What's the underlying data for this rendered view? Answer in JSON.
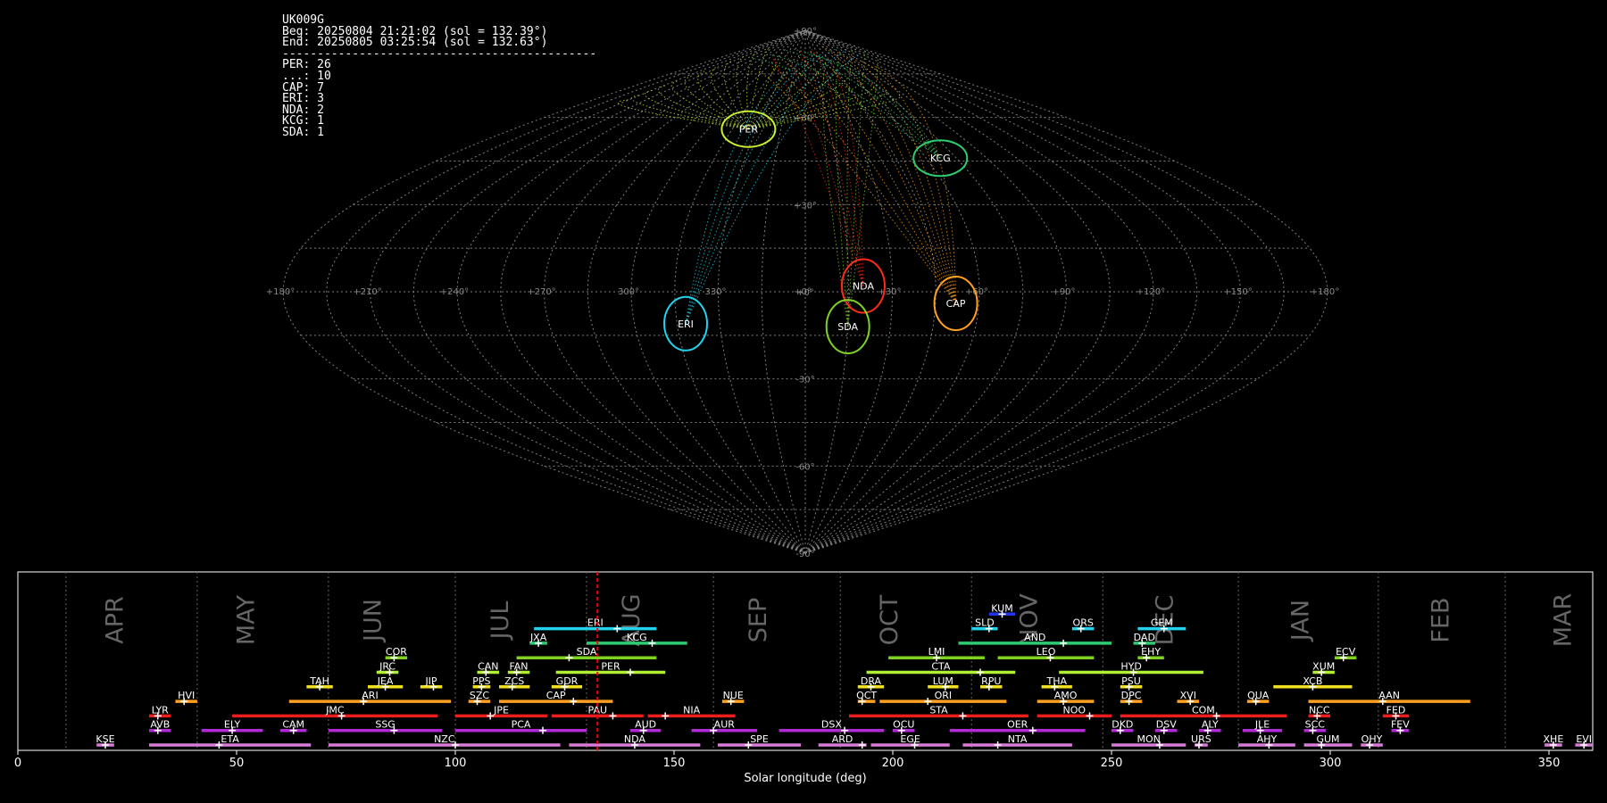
{
  "header": {
    "station": "UK009G",
    "begin": "Beg: 20250804 21:21:02 (sol = 132.39°)",
    "end": "End: 20250805 03:25:54 (sol = 132.63°)",
    "separator": "---------------------------------------------"
  },
  "summary": [
    {
      "text": "PER: 26"
    },
    {
      "text": "...: 10"
    },
    {
      "text": "CAP: 7"
    },
    {
      "text": "ERI: 3"
    },
    {
      "text": "NDA: 2"
    },
    {
      "text": "KCG: 1"
    },
    {
      "text": "SDA: 1"
    }
  ],
  "colors": {
    "background": "#000000",
    "grid": "#8c8c8c",
    "current_line": "#ff0000",
    "frame": "#ffffff"
  },
  "chart_data": [
    {
      "type": "scatter",
      "projection": "sinusoidal",
      "grid": true,
      "lon_tick_labels": [
        "+180°",
        "+150°",
        "+120°",
        "+90°",
        "+60°",
        "+30°",
        "+0°",
        "330°",
        "300°",
        "+270°",
        "+240°",
        "+210°",
        "+180°"
      ],
      "lat_tick_labels": [
        "+90°",
        "+60°",
        "+30°",
        "+0°",
        "-30°",
        "-60°",
        "-90°"
      ],
      "radiants": [
        {
          "name": "PER",
          "lon": 35,
          "lat": 56,
          "color": "#c8f032"
        },
        {
          "name": "KCG",
          "lon": 293,
          "lat": 46,
          "color": "#2ecc71"
        },
        {
          "name": "NDA",
          "lon": 340,
          "lat": 2,
          "color": "#ff2a1a"
        },
        {
          "name": "CAP",
          "lon": 308,
          "lat": -4,
          "color": "#ffa020"
        },
        {
          "name": "ERI",
          "lon": 42,
          "lat": -11,
          "color": "#22d3ee"
        },
        {
          "name": "SDA",
          "lon": 345,
          "lat": -12,
          "color": "#7ed321"
        }
      ]
    },
    {
      "type": "bar",
      "xlabel": "Solar longitude (deg)",
      "xlim": [
        0,
        360
      ],
      "x_tick_labels": [
        "0",
        "50",
        "100",
        "150",
        "200",
        "250",
        "300",
        "350"
      ],
      "current_sol": 132.5,
      "month_boundaries": [
        11,
        41,
        71,
        100,
        130,
        159,
        188,
        218,
        248,
        279,
        311,
        340
      ],
      "months": [
        {
          "label": "APR",
          "sol": 24
        },
        {
          "label": "MAY",
          "sol": 54
        },
        {
          "label": "JUN",
          "sol": 83
        },
        {
          "label": "JUL",
          "sol": 112
        },
        {
          "label": "AUG",
          "sol": 142
        },
        {
          "label": "SEP",
          "sol": 171
        },
        {
          "label": "OCT",
          "sol": 201
        },
        {
          "label": "NOV",
          "sol": 233
        },
        {
          "label": "DEC",
          "sol": 264
        },
        {
          "label": "JAN",
          "sol": 295
        },
        {
          "label": "FEB",
          "sol": 327
        },
        {
          "label": "MAR",
          "sol": 355
        }
      ],
      "showers": [
        {
          "name": "KUM",
          "start": 222,
          "end": 228,
          "peak": 225,
          "row": 10,
          "color": "#2233ee"
        },
        {
          "name": "ERI",
          "start": 118,
          "end": 146,
          "peak": 137,
          "row": 9,
          "color": "#22d3ee"
        },
        {
          "name": "SLD",
          "start": 218,
          "end": 224,
          "peak": 222,
          "row": 9,
          "color": "#22d3ee"
        },
        {
          "name": "ORS",
          "start": 241,
          "end": 246,
          "peak": 243,
          "row": 9,
          "color": "#22d3ee"
        },
        {
          "name": "GEM",
          "start": 256,
          "end": 267,
          "peak": 262,
          "row": 9,
          "color": "#22d3ee"
        },
        {
          "name": "JXA",
          "start": 117,
          "end": 121,
          "peak": 119,
          "row": 8,
          "color": "#2ecc71"
        },
        {
          "name": "KCG",
          "start": 130,
          "end": 153,
          "peak": 145,
          "row": 8,
          "color": "#2ecc71"
        },
        {
          "name": "AND",
          "start": 215,
          "end": 250,
          "peak": 239,
          "row": 8,
          "color": "#2ecc71"
        },
        {
          "name": "DAD",
          "start": 255,
          "end": 260,
          "peak": 257,
          "row": 8,
          "color": "#2ecc71"
        },
        {
          "name": "COR",
          "start": 84,
          "end": 89,
          "peak": 86,
          "row": 7,
          "color": "#7ed321"
        },
        {
          "name": "SDA",
          "start": 114,
          "end": 146,
          "peak": 126,
          "row": 7,
          "color": "#7ed321"
        },
        {
          "name": "LMI",
          "start": 199,
          "end": 221,
          "peak": 210,
          "row": 7,
          "color": "#7ed321"
        },
        {
          "name": "LEO",
          "start": 224,
          "end": 246,
          "peak": 236,
          "row": 7,
          "color": "#7ed321"
        },
        {
          "name": "EHY",
          "start": 256,
          "end": 262,
          "peak": 258,
          "row": 7,
          "color": "#7ed321"
        },
        {
          "name": "ECV",
          "start": 301,
          "end": 306,
          "peak": 303,
          "row": 7,
          "color": "#7ed321"
        },
        {
          "name": "JRC",
          "start": 82,
          "end": 87,
          "peak": 85,
          "row": 6,
          "color": "#b0f030"
        },
        {
          "name": "CAN",
          "start": 105,
          "end": 110,
          "peak": 107,
          "row": 6,
          "color": "#b0f030"
        },
        {
          "name": "FAN",
          "start": 112,
          "end": 117,
          "peak": 114,
          "row": 6,
          "color": "#b0f030"
        },
        {
          "name": "PER",
          "start": 123,
          "end": 148,
          "peak": 140,
          "row": 6,
          "color": "#b0f030"
        },
        {
          "name": "CTA",
          "start": 194,
          "end": 228,
          "peak": 220,
          "row": 6,
          "color": "#b0f030"
        },
        {
          "name": "HYD",
          "start": 238,
          "end": 271,
          "peak": 255,
          "row": 6,
          "color": "#b0f030"
        },
        {
          "name": "XUM",
          "start": 296,
          "end": 301,
          "peak": 298,
          "row": 6,
          "color": "#b0f030"
        },
        {
          "name": "TAH",
          "start": 66,
          "end": 72,
          "peak": 69,
          "row": 5,
          "color": "#f0e020"
        },
        {
          "name": "JEA",
          "start": 80,
          "end": 88,
          "peak": 84,
          "row": 5,
          "color": "#f0e020"
        },
        {
          "name": "JIP",
          "start": 92,
          "end": 97,
          "peak": 95,
          "row": 5,
          "color": "#f0e020"
        },
        {
          "name": "PPS",
          "start": 104,
          "end": 108,
          "peak": 106,
          "row": 5,
          "color": "#f0e020"
        },
        {
          "name": "ZCS",
          "start": 110,
          "end": 117,
          "peak": 113,
          "row": 5,
          "color": "#f0e020"
        },
        {
          "name": "GDR",
          "start": 122,
          "end": 129,
          "peak": 125,
          "row": 5,
          "color": "#f0e020"
        },
        {
          "name": "DRA",
          "start": 192,
          "end": 198,
          "peak": 195,
          "row": 5,
          "color": "#f0e020"
        },
        {
          "name": "LUM",
          "start": 208,
          "end": 215,
          "peak": 212,
          "row": 5,
          "color": "#f0e020"
        },
        {
          "name": "RPU",
          "start": 220,
          "end": 225,
          "peak": 222,
          "row": 5,
          "color": "#f0e020"
        },
        {
          "name": "THA",
          "start": 234,
          "end": 241,
          "peak": 237,
          "row": 5,
          "color": "#f0e020"
        },
        {
          "name": "PSU",
          "start": 252,
          "end": 257,
          "peak": 254,
          "row": 5,
          "color": "#f0e020"
        },
        {
          "name": "XCB",
          "start": 287,
          "end": 305,
          "peak": 296,
          "row": 5,
          "color": "#f0e020"
        },
        {
          "name": "HVI",
          "start": 36,
          "end": 41,
          "peak": 38,
          "row": 4,
          "color": "#ffa020"
        },
        {
          "name": "ARI",
          "start": 62,
          "end": 99,
          "peak": 79,
          "row": 4,
          "color": "#ffa020"
        },
        {
          "name": "SZC",
          "start": 103,
          "end": 108,
          "peak": 105,
          "row": 4,
          "color": "#ffa020"
        },
        {
          "name": "CAP",
          "start": 110,
          "end": 136,
          "peak": 127,
          "row": 4,
          "color": "#ffa020"
        },
        {
          "name": "NUE",
          "start": 161,
          "end": 166,
          "peak": 163,
          "row": 4,
          "color": "#ffa020"
        },
        {
          "name": "OCT",
          "start": 192,
          "end": 196,
          "peak": 193,
          "row": 4,
          "color": "#ffa020"
        },
        {
          "name": "ORI",
          "start": 197,
          "end": 226,
          "peak": 208,
          "row": 4,
          "color": "#ffa020"
        },
        {
          "name": "AMO",
          "start": 233,
          "end": 246,
          "peak": 239,
          "row": 4,
          "color": "#ffa020"
        },
        {
          "name": "DPC",
          "start": 252,
          "end": 257,
          "peak": 254,
          "row": 4,
          "color": "#ffa020"
        },
        {
          "name": "XVI",
          "start": 265,
          "end": 270,
          "peak": 268,
          "row": 4,
          "color": "#ffa020"
        },
        {
          "name": "QUA",
          "start": 281,
          "end": 286,
          "peak": 283,
          "row": 4,
          "color": "#ffa020"
        },
        {
          "name": "AAN",
          "start": 295,
          "end": 332,
          "peak": 312,
          "row": 4,
          "color": "#ffa020"
        },
        {
          "name": "LYR",
          "start": 30,
          "end": 35,
          "peak": 32,
          "row": 3,
          "color": "#ee1d1d"
        },
        {
          "name": "JMC",
          "start": 49,
          "end": 96,
          "peak": 74,
          "row": 3,
          "color": "#ee1d1d"
        },
        {
          "name": "JPE",
          "start": 100,
          "end": 121,
          "peak": 108,
          "row": 3,
          "color": "#ee1d1d"
        },
        {
          "name": "PAU",
          "start": 122,
          "end": 143,
          "peak": 136,
          "row": 3,
          "color": "#ee1d1d"
        },
        {
          "name": "NIA",
          "start": 144,
          "end": 164,
          "peak": 148,
          "row": 3,
          "color": "#ee1d1d"
        },
        {
          "name": "STA",
          "start": 190,
          "end": 231,
          "peak": 216,
          "row": 3,
          "color": "#ee1d1d"
        },
        {
          "name": "NOO",
          "start": 233,
          "end": 250,
          "peak": 245,
          "row": 3,
          "color": "#ee1d1d"
        },
        {
          "name": "COM",
          "start": 252,
          "end": 290,
          "peak": 274,
          "row": 3,
          "color": "#ee1d1d"
        },
        {
          "name": "NCC",
          "start": 295,
          "end": 300,
          "peak": 297,
          "row": 3,
          "color": "#ee1d1d"
        },
        {
          "name": "FED",
          "start": 312,
          "end": 318,
          "peak": 315,
          "row": 3,
          "color": "#ee1d1d"
        },
        {
          "name": "AVB",
          "start": 30,
          "end": 35,
          "peak": 32,
          "row": 2,
          "color": "#b02bd6"
        },
        {
          "name": "ELY",
          "start": 42,
          "end": 56,
          "peak": 49,
          "row": 2,
          "color": "#b02bd6"
        },
        {
          "name": "CAM",
          "start": 60,
          "end": 66,
          "peak": 63,
          "row": 2,
          "color": "#b02bd6"
        },
        {
          "name": "SSG",
          "start": 71,
          "end": 97,
          "peak": 86,
          "row": 2,
          "color": "#b02bd6"
        },
        {
          "name": "PCA",
          "start": 100,
          "end": 130,
          "peak": 120,
          "row": 2,
          "color": "#b02bd6"
        },
        {
          "name": "AUD",
          "start": 140,
          "end": 147,
          "peak": 143,
          "row": 2,
          "color": "#b02bd6"
        },
        {
          "name": "AUR",
          "start": 154,
          "end": 169,
          "peak": 159,
          "row": 2,
          "color": "#b02bd6"
        },
        {
          "name": "DSX",
          "start": 174,
          "end": 198,
          "peak": 189,
          "row": 2,
          "color": "#b02bd6"
        },
        {
          "name": "OCU",
          "start": 200,
          "end": 205,
          "peak": 202,
          "row": 2,
          "color": "#b02bd6"
        },
        {
          "name": "OER",
          "start": 213,
          "end": 244,
          "peak": 232,
          "row": 2,
          "color": "#b02bd6"
        },
        {
          "name": "DKD",
          "start": 250,
          "end": 255,
          "peak": 252,
          "row": 2,
          "color": "#b02bd6"
        },
        {
          "name": "DSV",
          "start": 260,
          "end": 265,
          "peak": 262,
          "row": 2,
          "color": "#b02bd6"
        },
        {
          "name": "ALY",
          "start": 270,
          "end": 275,
          "peak": 272,
          "row": 2,
          "color": "#b02bd6"
        },
        {
          "name": "JLE",
          "start": 280,
          "end": 289,
          "peak": 284,
          "row": 2,
          "color": "#b02bd6"
        },
        {
          "name": "SCC",
          "start": 294,
          "end": 299,
          "peak": 296,
          "row": 2,
          "color": "#b02bd6"
        },
        {
          "name": "FEV",
          "start": 314,
          "end": 318,
          "peak": 316,
          "row": 2,
          "color": "#b02bd6"
        },
        {
          "name": "KSE",
          "start": 18,
          "end": 22,
          "peak": 20,
          "row": 1,
          "color": "#d77bd7"
        },
        {
          "name": "ETA",
          "start": 30,
          "end": 67,
          "peak": 46,
          "row": 1,
          "color": "#d77bd7"
        },
        {
          "name": "NZC",
          "start": 71,
          "end": 124,
          "peak": 100,
          "row": 1,
          "color": "#d77bd7"
        },
        {
          "name": "NDA",
          "start": 126,
          "end": 156,
          "peak": 141,
          "row": 1,
          "color": "#d77bd7"
        },
        {
          "name": "SPE",
          "start": 160,
          "end": 179,
          "peak": 167,
          "row": 1,
          "color": "#d77bd7"
        },
        {
          "name": "ARD",
          "start": 183,
          "end": 194,
          "peak": 193,
          "row": 1,
          "color": "#d77bd7"
        },
        {
          "name": "EGE",
          "start": 195,
          "end": 213,
          "peak": 205,
          "row": 1,
          "color": "#d77bd7"
        },
        {
          "name": "NTA",
          "start": 216,
          "end": 241,
          "peak": 224,
          "row": 1,
          "color": "#d77bd7"
        },
        {
          "name": "MON",
          "start": 250,
          "end": 267,
          "peak": 261,
          "row": 1,
          "color": "#d77bd7"
        },
        {
          "name": "URS",
          "start": 269,
          "end": 272,
          "peak": 270,
          "row": 1,
          "color": "#d77bd7"
        },
        {
          "name": "AHY",
          "start": 279,
          "end": 292,
          "peak": 286,
          "row": 1,
          "color": "#d77bd7"
        },
        {
          "name": "GUM",
          "start": 294,
          "end": 305,
          "peak": 298,
          "row": 1,
          "color": "#d77bd7"
        },
        {
          "name": "OHY",
          "start": 307,
          "end": 312,
          "peak": 309,
          "row": 1,
          "color": "#d77bd7"
        },
        {
          "name": "XHE",
          "start": 349,
          "end": 353,
          "peak": 351,
          "row": 1,
          "color": "#d77bd7"
        },
        {
          "name": "EVI",
          "start": 356,
          "end": 360,
          "peak": 358,
          "row": 1,
          "color": "#d77bd7"
        }
      ]
    }
  ]
}
